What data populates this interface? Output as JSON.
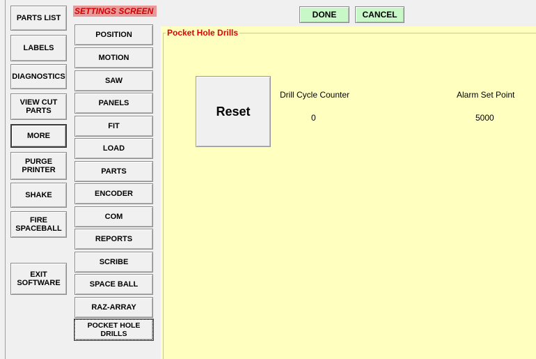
{
  "left_nav": {
    "parts_list": "PARTS LIST",
    "labels": "LABELS",
    "diagnostics": "DIAGNOSTICS",
    "view_cut_parts": "VIEW CUT\nPARTS",
    "more": "MORE",
    "purge_printer": "PURGE\nPRINTER",
    "shake": "SHAKE",
    "fire_spaceball": "FIRE\nSPACEBALL",
    "exit_software": "EXIT\nSOFTWARE"
  },
  "settings": {
    "title": "SETTINGS SCREEN",
    "items": [
      "POSITION",
      "MOTION",
      "SAW",
      "PANELS",
      "FIT",
      "LOAD",
      "PARTS",
      "ENCODER",
      "COM",
      "REPORTS",
      "SCRIBE",
      "SPACE BALL",
      "RAZ-ARRAY",
      "POCKET HOLE DRILLS"
    ],
    "selected": "POCKET HOLE DRILLS"
  },
  "toolbar": {
    "done": "DONE",
    "cancel": "CANCEL"
  },
  "panel": {
    "group_title": "Pocket Hole Drills",
    "reset_label": "Reset",
    "drill_cycle_counter_label": "Drill Cycle Counter",
    "drill_cycle_counter_value": "0",
    "alarm_set_point_label": "Alarm Set Point",
    "alarm_set_point_value": "5000"
  },
  "colors": {
    "panel_bg": "#ffffc0",
    "accent_red": "#e00000",
    "title_bg": "#e89a9a",
    "top_button_bg": "#c8f7c8"
  }
}
